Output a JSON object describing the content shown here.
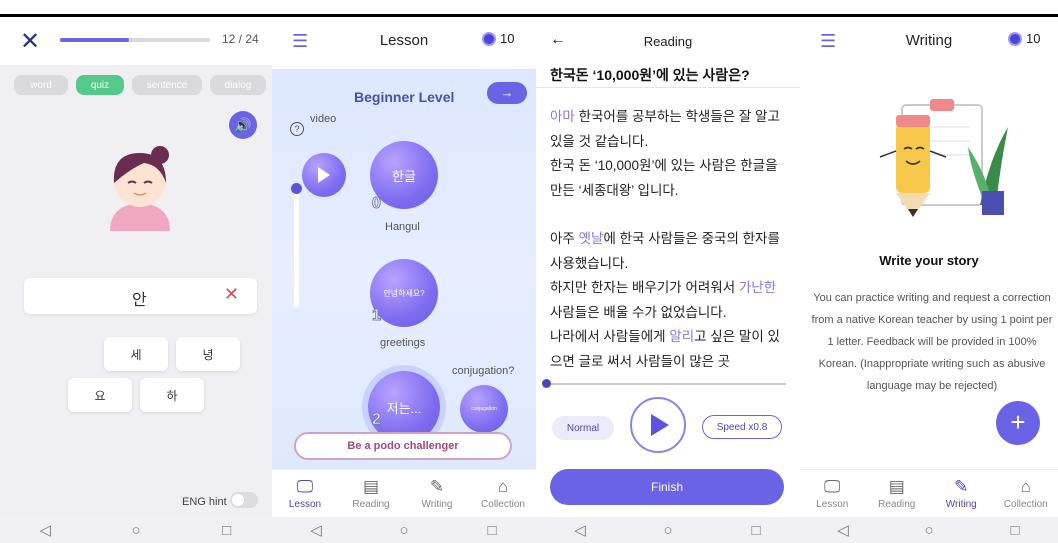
{
  "colors": {
    "accent": "#6a63e6",
    "correct_chip": "#55c98a",
    "error": "#e24a55",
    "dark_navy": "#263680"
  },
  "quiz": {
    "counter": "12 / 24",
    "progress_fraction": 0.46,
    "tabs": [
      {
        "label": "word",
        "active": false
      },
      {
        "label": "quiz",
        "active": true
      },
      {
        "label": "sentence",
        "active": false
      },
      {
        "label": "dialog",
        "active": false
      }
    ],
    "answer_text": "안",
    "answer_clear_icon": "close-icon",
    "keys": [
      "세",
      "녕",
      "요",
      "하"
    ],
    "hint_label": "ENG hint"
  },
  "lesson": {
    "title": "Lesson",
    "points": "10",
    "level_title": "Beginner Level",
    "video_label": "video",
    "nodes": [
      {
        "label": "한글",
        "caption": "Hangul",
        "num": "0"
      },
      {
        "label": "안녕하세요?",
        "caption": "greetings",
        "num": "1"
      },
      {
        "label": "저는...",
        "caption": "",
        "num": "2"
      },
      {
        "label": "conjugation",
        "caption": "conjugation?",
        "num": ""
      }
    ],
    "challenge_label": "Be a podo challenger"
  },
  "tabs": [
    {
      "label": "Lesson",
      "icon": "monitor-icon"
    },
    {
      "label": "Reading",
      "icon": "document-icon"
    },
    {
      "label": "Writing",
      "icon": "pencil-icon"
    },
    {
      "label": "Collection",
      "icon": "briefcase-icon"
    }
  ],
  "reading": {
    "title": "Reading",
    "question": "한국돈 ‘10,000원’에 있는 사람은?",
    "p1_hl": "아마",
    "p1_rest": " 한국어를 공부하는 학생들은 잘 알고 있을 것 같습니다.",
    "p2": "한국 돈 ‘10,000원’에 있는 사람은 한글을 만든 ‘세종대왕’ 입니다.",
    "p3_a": "아주 ",
    "p3_hl": "옛날",
    "p3_b": "에 한국 사람들은 중국의 한자를 사용했습니다.",
    "p4_a": "하지만 한자는 배우기가 어려워서 ",
    "p4_hl1": "가난한",
    "p4_b": " 사람들은 배울 수가 없었습니다.",
    "p4_c": "나라에서 사람들에게 ",
    "p4_hl2": "알리",
    "p4_d": "고 싶은 말이 있으면 글로 써서 사람들이 많은 곳",
    "normal_label": "Normal",
    "speed_label": "Speed x0.8",
    "finish_label": "Finish"
  },
  "writing": {
    "title": "Writing",
    "points": "10",
    "heading": "Write your story",
    "description": "You can practice writing and request a correction from a native Korean teacher by using 1 point per 1 letter. Feedback will be provided in 100% Korean. (Inappropriate writing such as abusive language may be rejected)",
    "fab_label": "+"
  },
  "system_nav": {
    "back": "◁",
    "home": "○",
    "recent": "□"
  }
}
